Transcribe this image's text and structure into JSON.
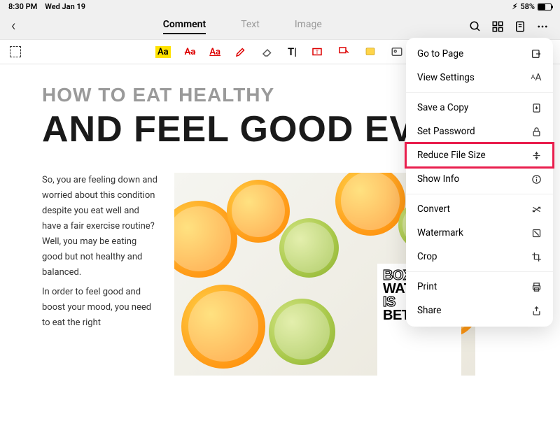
{
  "status": {
    "time": "8:30 PM",
    "date": "Wed Jan 19",
    "battery": "58%"
  },
  "nav": {
    "tabs": {
      "comment": "Comment",
      "text": "Text",
      "image": "Image"
    }
  },
  "article": {
    "heading_small": "HOW TO EAT HEALTHY",
    "heading_large": "AND FEEL GOOD EVERY",
    "p1": "So, you are feeling down and worried about this condition despite you eat well and have a fair exercise routine? Well, you may be eating good but not healthy and balanced.",
    "p2": "In order to feel good and boost your mood, you need to eat the right",
    "carton_l1": "BOXED",
    "carton_l2": "WATER",
    "carton_l3": "IS",
    "carton_l4": "BETTER."
  },
  "menu": {
    "items": [
      {
        "label": "Go to Page"
      },
      {
        "label": "View Settings"
      },
      {
        "label": "Save a Copy"
      },
      {
        "label": "Set Password"
      },
      {
        "label": "Reduce File Size",
        "highlight": true
      },
      {
        "label": "Show Info"
      },
      {
        "label": "Convert"
      },
      {
        "label": "Watermark"
      },
      {
        "label": "Crop"
      },
      {
        "label": "Print"
      },
      {
        "label": "Share"
      }
    ]
  }
}
